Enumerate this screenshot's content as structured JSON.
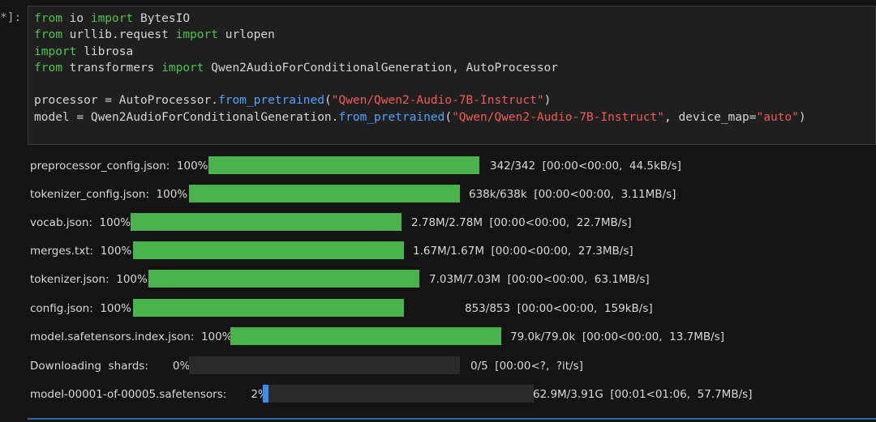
{
  "cell": {
    "prompt": "*]:",
    "lines": [
      [
        [
          "kw",
          "from"
        ],
        [
          "op",
          " io "
        ],
        [
          "kw",
          "import"
        ],
        [
          "op",
          " BytesIO"
        ]
      ],
      [
        [
          "kw",
          "from"
        ],
        [
          "op",
          " urllib.request "
        ],
        [
          "kw",
          "import"
        ],
        [
          "op",
          " urlopen"
        ]
      ],
      [
        [
          "kw",
          "import"
        ],
        [
          "op",
          " librosa"
        ]
      ],
      [
        [
          "kw",
          "from"
        ],
        [
          "op",
          " transformers "
        ],
        [
          "kw",
          "import"
        ],
        [
          "op",
          " Qwen2AudioForConditionalGeneration, AutoProcessor"
        ]
      ],
      [
        [
          "op",
          ""
        ]
      ],
      [
        [
          "op",
          "processor = AutoProcessor."
        ],
        [
          "fn",
          "from_pretrained"
        ],
        [
          "op",
          "("
        ],
        [
          "str",
          "\"Qwen/Qwen2-Audio-7B-Instruct\""
        ],
        [
          "op",
          ")"
        ]
      ],
      [
        [
          "op",
          "model = Qwen2AudioForConditionalGeneration."
        ],
        [
          "fn",
          "from_pretrained"
        ],
        [
          "op",
          "("
        ],
        [
          "str",
          "\"Qwen/Qwen2-Audio-7B-Instruct\""
        ],
        [
          "op",
          ", device_map="
        ],
        [
          "str",
          "\"auto\""
        ],
        [
          "op",
          ")"
        ]
      ]
    ]
  },
  "progress": [
    {
      "label": "preprocessor_config.json:  100%",
      "fraction": 1.0,
      "stats": "342/342  [00:00<00:00,  44.5kB/s]"
    },
    {
      "label": "tokenizer_config.json:  100%",
      "fraction": 1.0,
      "stats": "638k/638k  [00:00<00:00,  3.11MB/s]"
    },
    {
      "label": "vocab.json:  100%",
      "fraction": 1.0,
      "stats": "2.78M/2.78M  [00:00<00:00,  22.7MB/s]"
    },
    {
      "label": "merges.txt:  100%",
      "fraction": 1.0,
      "stats": "1.67M/1.67M  [00:00<00:00,  27.3MB/s]"
    },
    {
      "label": "tokenizer.json:  100%",
      "fraction": 1.0,
      "stats": "7.03M/7.03M  [00:00<00:00,  63.1MB/s]"
    },
    {
      "label": "config.json:  100%",
      "fraction": 1.0,
      "stats": "853/853  [00:00<00:00,  159kB/s]"
    },
    {
      "label": "model.safetensors.index.json:  100%",
      "fraction": 1.0,
      "stats": "79.0k/79.0k  [00:00<00:00,  13.7MB/s]"
    },
    {
      "label": "Downloading  shards:       0%",
      "fraction": 0.0,
      "stats": "0/5  [00:00<?,  ?it/s]"
    },
    {
      "label": "model-00001-of-00005.safetensors:       2%",
      "fraction": 0.02,
      "stats": "62.9M/3.91G  [00:01<01:06,  57.7MB/s]",
      "color": "blue"
    }
  ]
}
